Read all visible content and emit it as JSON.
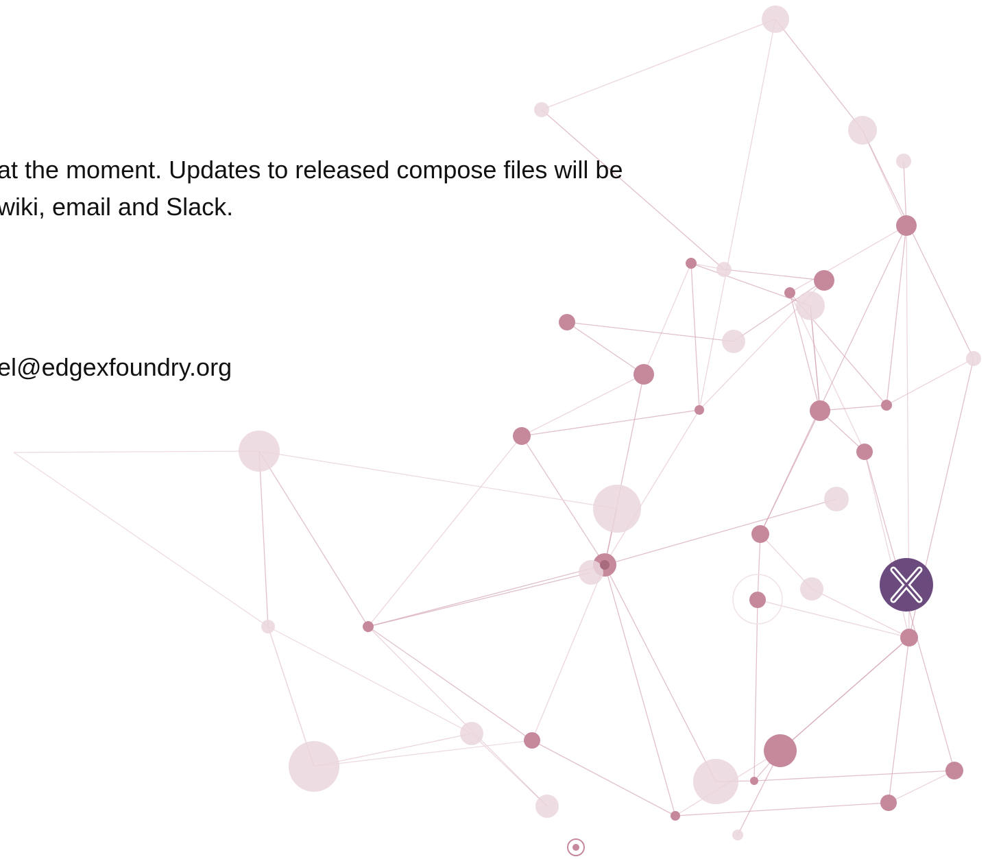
{
  "notice": {
    "line1": "at the moment. Updates to released compose files will be",
    "line2": "wiki, email and Slack."
  },
  "contact": {
    "email": "el@edgexfoundry.org"
  },
  "colors": {
    "background": "#ffffff",
    "text": "#111111",
    "node_strong": "#c5899b",
    "node_light": "#ead6dd",
    "edge": "#d4a5b3",
    "logo_badge": "#6b4a7e"
  },
  "decoration": {
    "background_graphic": "network-graph",
    "logo_icon": "edgex-x-logo-icon"
  }
}
